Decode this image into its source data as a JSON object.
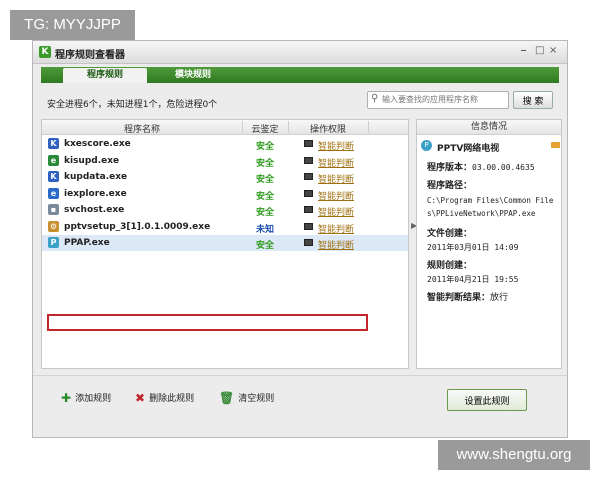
{
  "overlay": {
    "tag": "TG: MYYJJPP",
    "watermark": "www.shengtu.org"
  },
  "window": {
    "title": "程序规则查看器",
    "controls": [
      "⎯",
      "□",
      "×"
    ]
  },
  "tabs": [
    {
      "label": "程序规则",
      "active": true
    },
    {
      "label": "模块规则",
      "active": false
    }
  ],
  "summary": "安全进程6个，未知进程1个，危险进程0个",
  "search": {
    "placeholder": "输入要查找的应用程序名称",
    "button": "搜 索"
  },
  "list": {
    "headers": [
      "程序名称",
      "云鉴定",
      "操作权限"
    ],
    "rows": [
      {
        "name": "kxescore.exe",
        "status": "安全",
        "perm": "智能判断",
        "icon_color": "#3060c0",
        "icon": "k-icon"
      },
      {
        "name": "kisupd.exe",
        "status": "安全",
        "perm": "智能判断",
        "icon_color": "#2a8a3a",
        "icon": "globe-icon"
      },
      {
        "name": "kupdata.exe",
        "status": "安全",
        "perm": "智能判断",
        "icon_color": "#3060c0",
        "icon": "k-icon"
      },
      {
        "name": "iexplore.exe",
        "status": "安全",
        "perm": "智能判断",
        "icon_color": "#2a6ac8",
        "icon": "ie-icon"
      },
      {
        "name": "svchost.exe",
        "status": "安全",
        "perm": "智能判断",
        "icon_color": "#7a8a9a",
        "icon": "window-icon"
      },
      {
        "name": "pptvsetup_3[1].0.1.0009.exe",
        "status": "未知",
        "perm": "智能判断",
        "icon_color": "#c89030",
        "icon": "setup-icon"
      },
      {
        "name": "PPAP.exe",
        "status": "安全",
        "perm": "智能判断",
        "icon_color": "#3aa0c8",
        "icon": "pptv-icon",
        "selected": true
      }
    ],
    "colors": {
      "safe": "#2f9a1e",
      "unknown": "#1d4fb0"
    }
  },
  "info": {
    "header": "信息情况",
    "app_name": "PPTV网络电视",
    "version_label": "程序版本：",
    "version": "03.00.00.4635",
    "path_label": "程序路径：",
    "path_line1": "C:\\Program Files\\Common File",
    "path_line2": "s\\PPLiveNetwork\\PPAP.exe",
    "created_label": "文件创建：",
    "created": "2011年03月01日 14:09",
    "rule_label": "规则创建：",
    "rule_created": "2011年04月21日 19:55",
    "result_label": "智能判断结果：",
    "result": "放行"
  },
  "footer": {
    "add": "添加规则",
    "delete": "删除此规则",
    "clear": "清空规则",
    "set": "设置此规则"
  }
}
